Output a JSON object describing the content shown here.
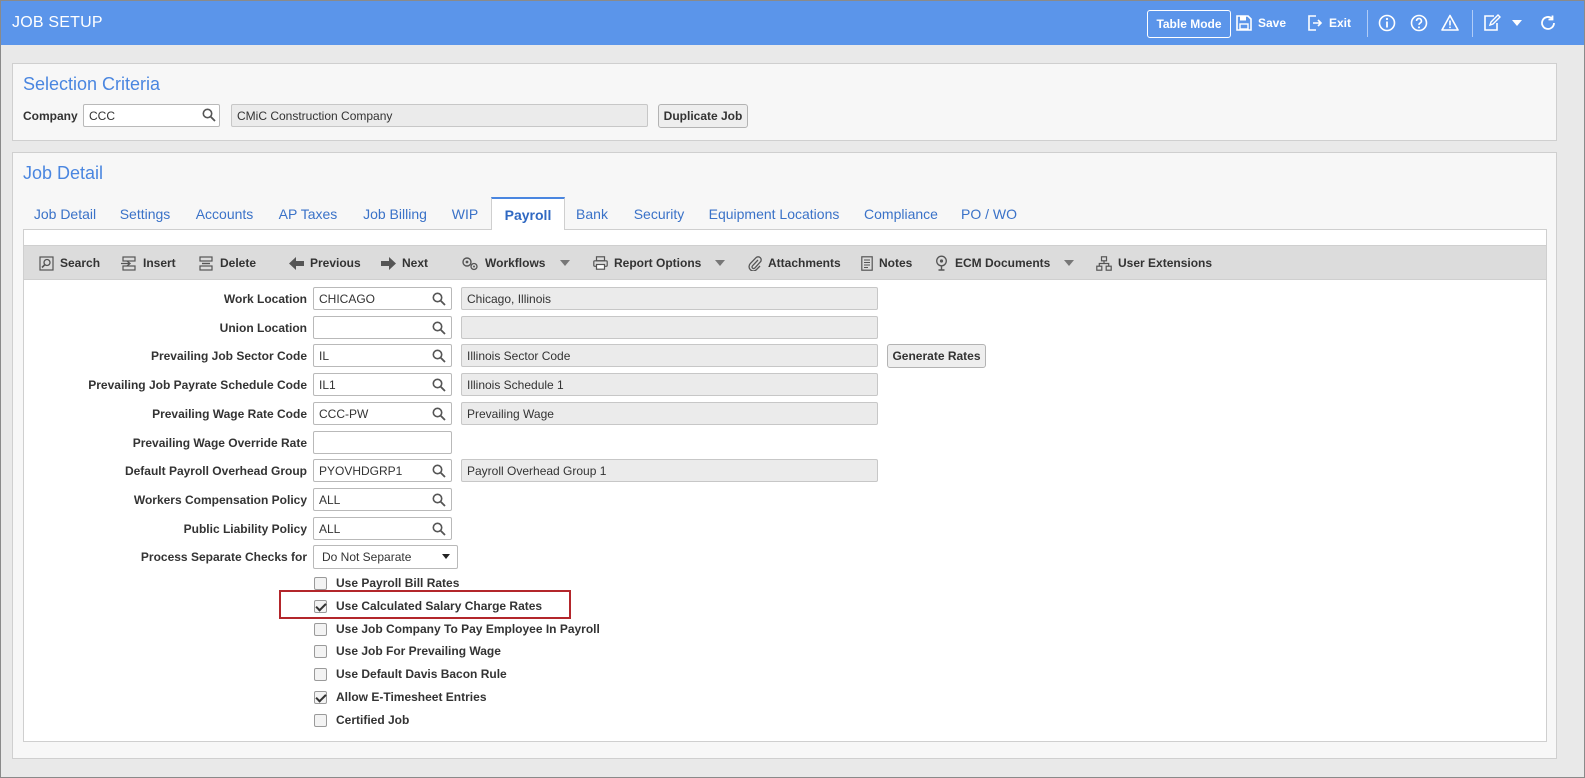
{
  "header": {
    "title": "JOB SETUP",
    "table_mode_label": "Table Mode",
    "save_label": "Save",
    "exit_label": "Exit",
    "icons": [
      "info-icon",
      "help-icon",
      "warning-icon",
      "edit-form-icon",
      "chevron-down-icon",
      "refresh-icon"
    ]
  },
  "selection": {
    "title": "Selection Criteria",
    "company_label": "Company",
    "company_value": "CCC",
    "company_name": "CMiC Construction Company",
    "duplicate_label": "Duplicate Job"
  },
  "job_detail": {
    "title": "Job Detail",
    "tabs": [
      {
        "label": "Job Detail",
        "active": false
      },
      {
        "label": "Settings",
        "active": false
      },
      {
        "label": "Accounts",
        "active": false
      },
      {
        "label": "AP Taxes",
        "active": false
      },
      {
        "label": "Job Billing",
        "active": false
      },
      {
        "label": "WIP",
        "active": false
      },
      {
        "label": "Payroll",
        "active": true
      },
      {
        "label": "Bank",
        "active": false
      },
      {
        "label": "Security",
        "active": false
      },
      {
        "label": "Equipment Locations",
        "active": false
      },
      {
        "label": "Compliance",
        "active": false
      },
      {
        "label": "PO / WO",
        "active": false
      }
    ],
    "toolbar": {
      "search": "Search",
      "insert": "Insert",
      "delete": "Delete",
      "previous": "Previous",
      "next": "Next",
      "workflows": "Workflows",
      "report_options": "Report Options",
      "attachments": "Attachments",
      "notes": "Notes",
      "ecm_documents": "ECM Documents",
      "user_extensions": "User Extensions"
    }
  },
  "payroll": {
    "fields": [
      {
        "label": "Work Location",
        "value": "CHICAGO",
        "desc": "Chicago, Illinois"
      },
      {
        "label": "Union Location",
        "value": "",
        "desc": ""
      },
      {
        "label": "Prevailing Job Sector Code",
        "value": "IL",
        "desc": "Illinois Sector Code"
      },
      {
        "label": "Prevailing Job Payrate Schedule Code",
        "value": "IL1",
        "desc": "Illinois Schedule 1"
      },
      {
        "label": "Prevailing Wage Rate Code",
        "value": "CCC-PW",
        "desc": "Prevailing Wage"
      },
      {
        "label": "Prevailing Wage Override Rate",
        "value": ""
      },
      {
        "label": "Default Payroll Overhead Group",
        "value": "PYOVHDGRP1",
        "desc": "Payroll Overhead Group 1"
      },
      {
        "label": "Workers Compensation Policy",
        "value": "ALL"
      },
      {
        "label": "Public Liability Policy",
        "value": "ALL"
      }
    ],
    "generate_rates_label": "Generate Rates",
    "separate_checks_label": "Process Separate Checks for",
    "separate_checks_value": "Do Not Separate",
    "checkboxes": [
      {
        "label": "Use Payroll Bill Rates",
        "checked": false
      },
      {
        "label": "Use Calculated Salary Charge Rates",
        "checked": true
      },
      {
        "label": "Use Job Company To Pay Employee In Payroll",
        "checked": false
      },
      {
        "label": "Use Job For Prevailing Wage",
        "checked": false
      },
      {
        "label": "Use Default Davis Bacon Rule",
        "checked": false
      },
      {
        "label": "Allow E-Timesheet Entries",
        "checked": true
      },
      {
        "label": "Certified Job",
        "checked": false
      }
    ]
  }
}
